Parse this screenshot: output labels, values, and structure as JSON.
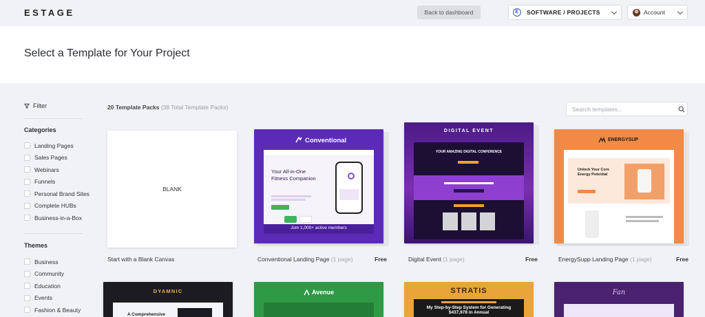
{
  "header": {
    "logo": "ESTAGE",
    "back_label": "Back to dashboard",
    "project_label": "SOFTWARE / PROJECTS",
    "account_label": "Account"
  },
  "page": {
    "title": "Select a Template for Your Project"
  },
  "sidebar": {
    "filter_label": "Filter",
    "categories_title": "Categories",
    "categories": [
      "Landing Pages",
      "Sales Pages",
      "Webinars",
      "Funnels",
      "Personal Brand Sites",
      "Complete HUBs",
      "Business-in-a-Box"
    ],
    "themes_title": "Themes",
    "themes": [
      "Business",
      "Community",
      "Education",
      "Events",
      "Fashion & Beauty"
    ]
  },
  "listing": {
    "count_label": "20 Template Packs",
    "total_label": "(38 Total Template Packs)",
    "search_placeholder": "Search templates..."
  },
  "templates": [
    {
      "name": "Start with a Blank Canvas",
      "pages": "",
      "price": "",
      "thumb_text": "BLANK"
    },
    {
      "name": "Conventional Landing Page",
      "pages": "(1 page)",
      "price": "Free",
      "brand": "Conventional",
      "headline": "Your All-in-One Fitness Companion",
      "members": "Join 1,000+ active members"
    },
    {
      "name": "Digital Event",
      "pages": "(1 page)",
      "price": "Free",
      "brand": "DIGITAL EVENT",
      "headline": "YOUR AMAZING DIGITAL CONFERENCE"
    },
    {
      "name": "EnergySupp Landing Page",
      "pages": "(1 page)",
      "price": "Free",
      "brand": "ENERGYSUP",
      "headline": "Unlock Your Core Energy Potential"
    }
  ],
  "templates_row2": [
    {
      "brand": "DYAMNIC",
      "headline": "A Comprehensive"
    },
    {
      "brand": "Avenue"
    },
    {
      "brand": "STRATIS",
      "headline": "My Step-by-Step System for Generating $437,978 in Annual"
    },
    {
      "brand": "Fan"
    }
  ],
  "colors": {
    "accent": "#3b55c7",
    "conventional_purple": "#5b2bb8",
    "event_purple": "#7a2fb0",
    "energy_orange": "#f08a45",
    "avenue_green": "#2f9a45",
    "stratis_orange": "#e9a53a"
  }
}
